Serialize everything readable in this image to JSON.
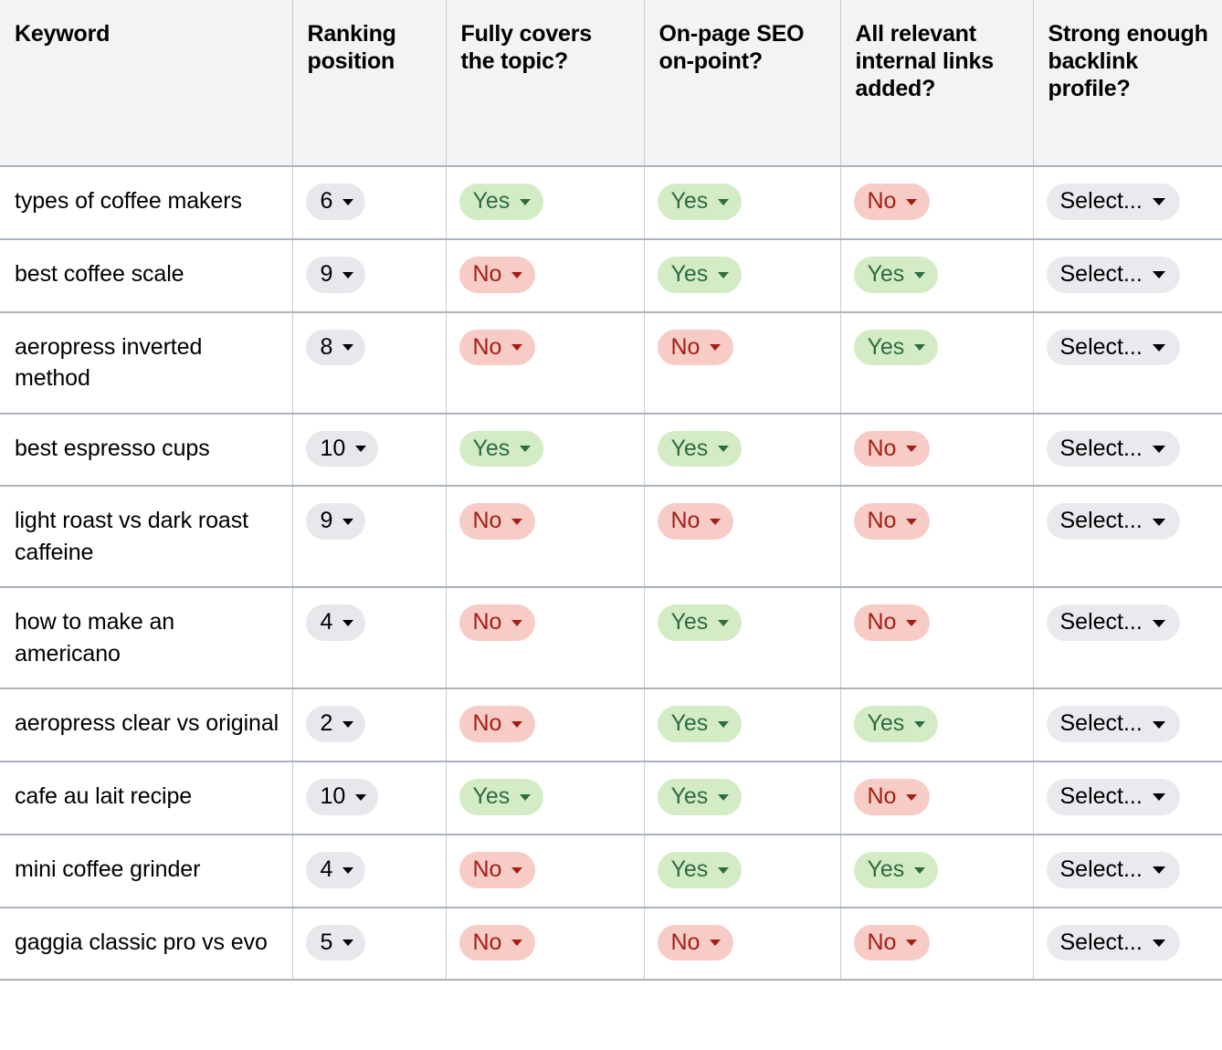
{
  "table": {
    "columns": [
      {
        "key": "keyword",
        "label": "Keyword"
      },
      {
        "key": "rank",
        "label": "Ranking position"
      },
      {
        "key": "covers",
        "label": "Fully covers the topic?"
      },
      {
        "key": "seo",
        "label": "On-page SEO on-point?"
      },
      {
        "key": "links",
        "label": "All relevant internal links added?"
      },
      {
        "key": "backlink",
        "label": "Strong enough backlink profile?"
      }
    ],
    "placeholder_label": "Select...",
    "option_yes": "Yes",
    "option_no": "No",
    "rows": [
      {
        "keyword": "types of coffee makers",
        "rank": "6",
        "covers": "Yes",
        "seo": "Yes",
        "links": "No",
        "backlink": "Select..."
      },
      {
        "keyword": "best coffee scale",
        "rank": "9",
        "covers": "No",
        "seo": "Yes",
        "links": "Yes",
        "backlink": "Select..."
      },
      {
        "keyword": "aeropress inverted method",
        "rank": "8",
        "covers": "No",
        "seo": "No",
        "links": "Yes",
        "backlink": "Select..."
      },
      {
        "keyword": "best espresso cups",
        "rank": "10",
        "covers": "Yes",
        "seo": "Yes",
        "links": "No",
        "backlink": "Select..."
      },
      {
        "keyword": "light roast vs dark roast caffeine",
        "rank": "9",
        "covers": "No",
        "seo": "No",
        "links": "No",
        "backlink": "Select..."
      },
      {
        "keyword": "how to make an americano",
        "rank": "4",
        "covers": "No",
        "seo": "Yes",
        "links": "No",
        "backlink": "Select..."
      },
      {
        "keyword": "aeropress clear vs original",
        "rank": "2",
        "covers": "No",
        "seo": "Yes",
        "links": "Yes",
        "backlink": "Select..."
      },
      {
        "keyword": "cafe au lait recipe",
        "rank": "10",
        "covers": "Yes",
        "seo": "Yes",
        "links": "No",
        "backlink": "Select..."
      },
      {
        "keyword": "mini coffee grinder",
        "rank": "4",
        "covers": "No",
        "seo": "Yes",
        "links": "Yes",
        "backlink": "Select..."
      },
      {
        "keyword": "gaggia classic pro vs evo",
        "rank": "5",
        "covers": "No",
        "seo": "No",
        "links": "No",
        "backlink": "Select..."
      }
    ]
  },
  "colors": {
    "header_bg": "#f1f3f4",
    "grid_line": "#aab2ba",
    "yes_bg": "#d3ecc5",
    "yes_fg": "#2f6b43",
    "no_bg": "#f7ccc6",
    "no_fg": "#a31f16",
    "neutral_bg": "#e6e8ec",
    "neutral_fg": "#000000"
  }
}
